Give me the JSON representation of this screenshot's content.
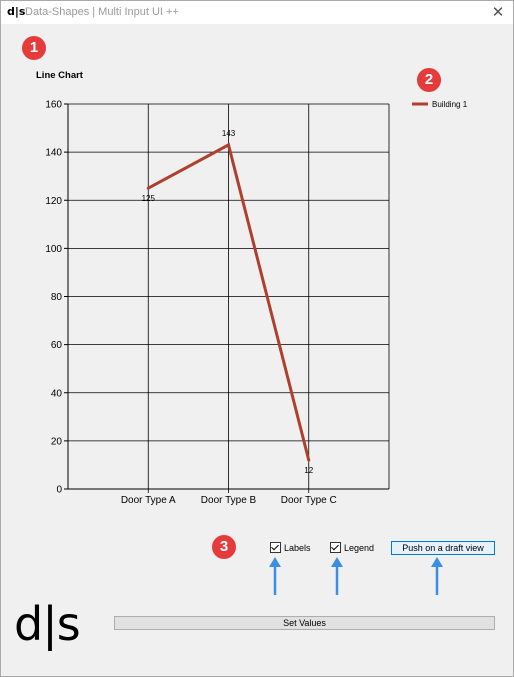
{
  "window": {
    "title_logo": "d|s",
    "title": "Data-Shapes | Multi Input UI ++",
    "close_glyph": "✕"
  },
  "badges": [
    "1",
    "2",
    "3"
  ],
  "chart_data": {
    "type": "line",
    "title": "Line Chart",
    "categories": [
      "Door Type A",
      "Door Type B",
      "Door Type C"
    ],
    "series": [
      {
        "name": "Building 1",
        "values": [
          125,
          143,
          12
        ],
        "color": "#b0402e"
      }
    ],
    "data_labels": [
      "125",
      "143",
      "12"
    ],
    "ylim": [
      0,
      160
    ],
    "y_ticks": [
      0,
      20,
      40,
      60,
      80,
      100,
      120,
      140,
      160
    ],
    "grid": true,
    "legend_position": "top-right"
  },
  "options": {
    "labels_label": "Labels",
    "labels_checked": true,
    "legend_label": "Legend",
    "legend_checked": true,
    "push_button_label": "Push on a draft view"
  },
  "footer": {
    "logo_text": "d|s",
    "set_values_label": "Set Values"
  },
  "annotation_arrow_color": "#3a8ee6",
  "badge_color": "#e53b3b"
}
